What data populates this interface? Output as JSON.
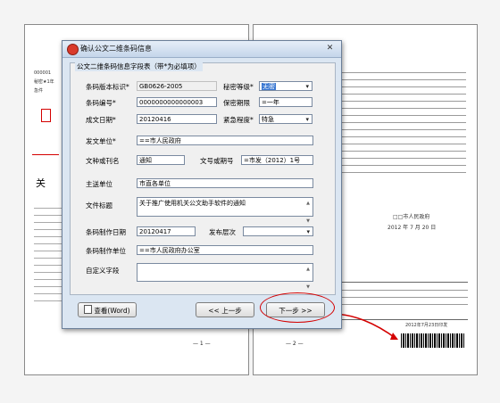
{
  "dialog": {
    "title": "确认公文二维条码信息",
    "close_glyph": "✕",
    "group_title": "公文二维条码信息字段表（带*为必填项）",
    "fields": {
      "version_label": "条码版本标识*",
      "version_value": "GB0626-2005",
      "secret_level_label": "秘密等级*",
      "secret_level_value": "无密",
      "code_number_label": "条码编号*",
      "code_number_value": "0000000000000003",
      "secret_period_label": "保密期限",
      "secret_period_value": "=一年",
      "date_label": "成文日期*",
      "date_value": "20120416",
      "urgency_label": "紧急程度*",
      "urgency_value": "特急",
      "issuer_label": "发文单位*",
      "issuer_value": "==市人民政府",
      "doctype_label": "文种或刊名",
      "doctype_value": "通知",
      "docnum_label": "文号或期号",
      "docnum_value": "=市发（2012）1号",
      "recipient_label": "主送单位",
      "recipient_value": "市直各单位",
      "doctitle_label": "文件标题",
      "doctitle_value": "关于推广使用机关公文助手软件的通知",
      "barcode_date_label": "条码制作日期",
      "barcode_date_value": "20120417",
      "publish_level_label": "发布层次",
      "publish_level_value": "",
      "barcode_unit_label": "条码制作单位",
      "barcode_unit_value": "==市人民政府办公室",
      "custom_label": "自定义字段",
      "custom_value": ""
    },
    "buttons": {
      "view_word": "查看(Word)",
      "prev": "<< 上一步",
      "next": "下一步 >>"
    }
  },
  "document": {
    "left_header_number": "000001",
    "left_header_secret": "秘密★1年",
    "left_header_urgency": "急件",
    "left_heading_fragment": "关",
    "right_signature": "□□市人民政府",
    "right_date": "2012 年 7 月 20 日",
    "right_footer_date": "2012年7月23日印发",
    "left_page_number": "— 1 —",
    "right_page_number": "— 2 —"
  }
}
